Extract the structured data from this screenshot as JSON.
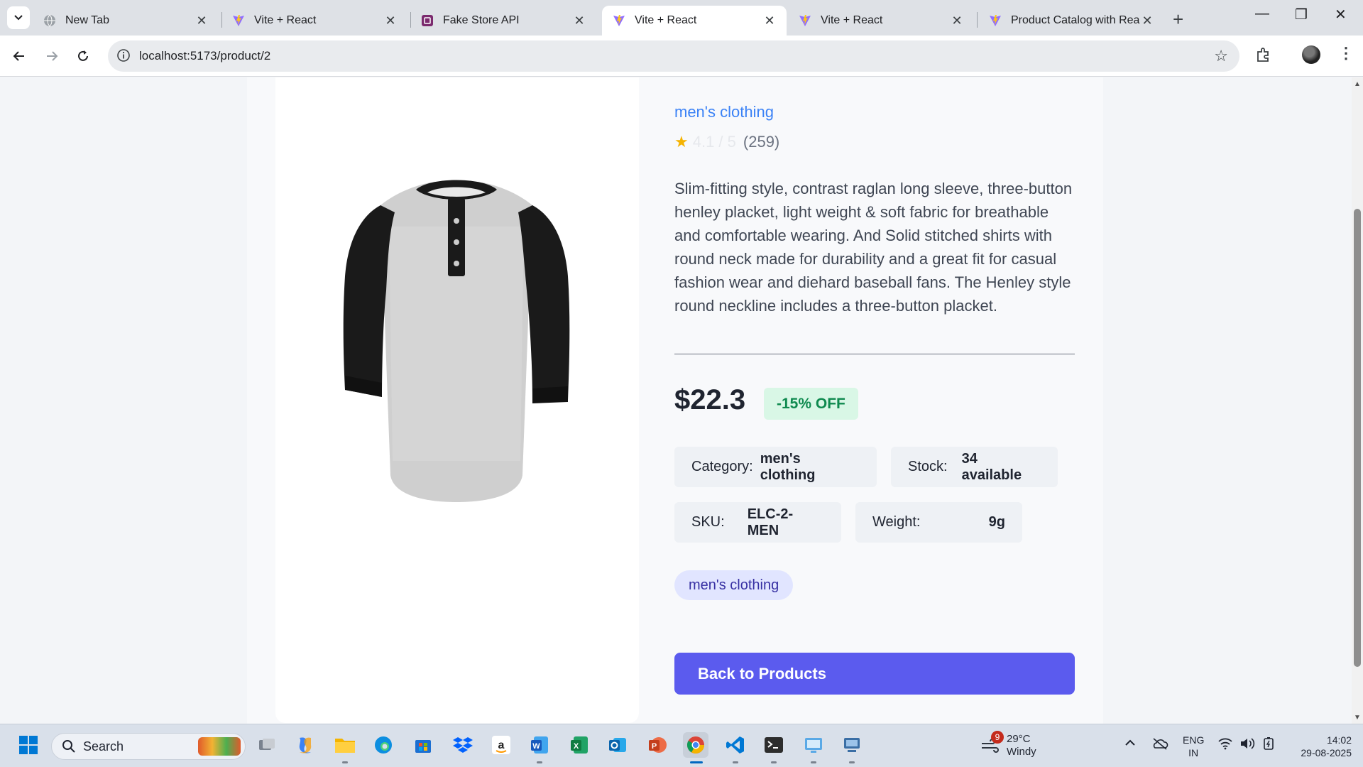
{
  "browser": {
    "tabs": [
      {
        "title": "New Tab",
        "icon": "globe-icon"
      },
      {
        "title": "Vite + React",
        "icon": "vite-icon"
      },
      {
        "title": "Fake Store API",
        "icon": "fakestore-icon"
      },
      {
        "title": "Vite + React",
        "icon": "vite-icon",
        "active": true
      },
      {
        "title": "Vite + React",
        "icon": "vite-icon"
      },
      {
        "title": "Product Catalog with React",
        "icon": "vite-icon"
      }
    ],
    "url": "localhost:5173/product/2"
  },
  "product": {
    "category_link": "men's clothing",
    "rating_score": "4.1 / 5",
    "rating_count": "(259)",
    "description": "Slim-fitting style, contrast raglan long sleeve, three-button henley placket, light weight & soft fabric for breathable and comfortable wearing. And Solid stitched shirts with round neck made for durability and a great fit for casual fashion wear and diehard baseball fans. The Henley style round neckline includes a three-button placket.",
    "price": "$22.3",
    "discount": "-15% OFF",
    "specs": {
      "category_label": "Category:",
      "category_value": "men's clothing",
      "stock_label": "Stock:",
      "stock_value": "34 available",
      "sku_label": "SKU:",
      "sku_value": "ELC-2-MEN",
      "weight_label": "Weight:",
      "weight_value": "9g"
    },
    "tag": "men's clothing",
    "back_button": "Back to Products"
  },
  "taskbar": {
    "search_label": "Search",
    "weather_temp": "29°C",
    "weather_desc": "Windy",
    "weather_badge": "9",
    "lang_line1": "ENG",
    "lang_line2": "IN",
    "time": "14:02",
    "date": "29-08-2025"
  },
  "colors": {
    "accent": "#5b5bee",
    "link": "#3b82f6",
    "discount_bg": "#d9f7e6",
    "discount_text": "#0f8a4f",
    "star": "#f5b301"
  }
}
